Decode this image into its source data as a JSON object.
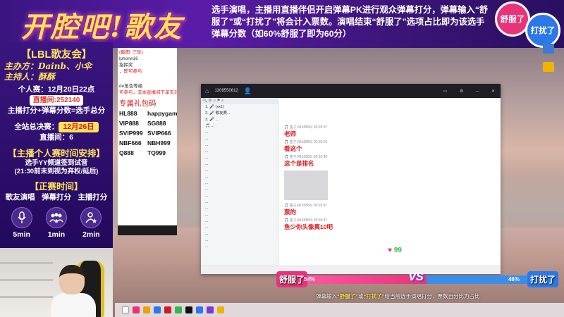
{
  "banner": {
    "title": "开腔吧!歌友",
    "rules": "选手演唱，主播用直播伴侣开启弹幕PK进行观众弹幕打分，弹幕输入“舒服了”或“打扰了”将会计入票数。演唱结束“舒服了”选项占比即为该选手弹幕分数（如60%舒服了即为60分）",
    "badge_left": "舒服了",
    "badge_right": "打扰了"
  },
  "left_panel": {
    "title": "【LBL歌友会】",
    "organizer": "主办方：Dainb、小伞",
    "hosts": "主持人：酥酥",
    "personal_label": "个人赛：",
    "personal_time": "12月20日22点",
    "room_label": "直播间:252140",
    "score_formula": "主播打分+弹幕分数=选手总分",
    "final_label": "全站总决赛：",
    "final_date": "12月26日",
    "slots_label": "直播间：6",
    "schedule_head": "【主播个人赛时间安排】",
    "schedule_line1": "选手YY频道签到试音",
    "schedule_line2": "(21:30前未到视为弃权/延后)",
    "time_head": "【正赛时间】",
    "segments": [
      {
        "label": "歌友演唱",
        "icon": "microphone-icon",
        "min": "5min"
      },
      {
        "label": "弹幕打分",
        "icon": "audience-icon",
        "min": "1min"
      },
      {
        "label": "主播打分",
        "icon": "star-user-icon",
        "min": "2min"
      }
    ]
  },
  "doc": {
    "line1": "iphone16",
    "line2": "指挥奖",
    "line3": "，即可参与",
    "line4": "de角色等级",
    "line5": "可参与，非本直播间下单无效",
    "heading": "专属礼包码",
    "codes": [
      "HL888",
      "happygame",
      "VIP888",
      "SG888",
      "SVIP999",
      "SVIP666",
      "NBF666",
      "NBH999",
      "Q888",
      "TQ999"
    ]
  },
  "yy": {
    "room_id": "1309550612",
    "messages": [
      {
        "meta": "🎵 金子(4155856) 00:25:57",
        "text": "老师"
      },
      {
        "meta": "🎵 金子(4155856) 00:26:26",
        "text": "看这个"
      },
      {
        "meta": "🎵 金子(4155856) 00:26:40",
        "text": "这个是排名"
      },
      {
        "meta": "🎵 金子(4155856) 00:26:47",
        "text": "票的"
      },
      {
        "meta": "🎵 金子(4155856) 00:26:47",
        "text": "鱼少你头像真10吧"
      }
    ],
    "hearts_count": "99"
  },
  "vote": {
    "left_label": "舒服了",
    "left_pct": "54%",
    "left_fraction": 0.54,
    "right_label": "打扰了",
    "right_pct": "46%",
    "subtitle_prefix": "弹幕输入",
    "subtitle_a": "“舒服了”",
    "subtitle_mid": "或",
    "subtitle_b": "“打扰了”",
    "subtitle_rest": "给当前选手演唱打分，票数百分比为占比"
  },
  "colors": {
    "banner_purple": "#3a1580",
    "accent_yellow": "#ffe35a",
    "pink": "#e8327a",
    "blue": "#2b78e8"
  }
}
